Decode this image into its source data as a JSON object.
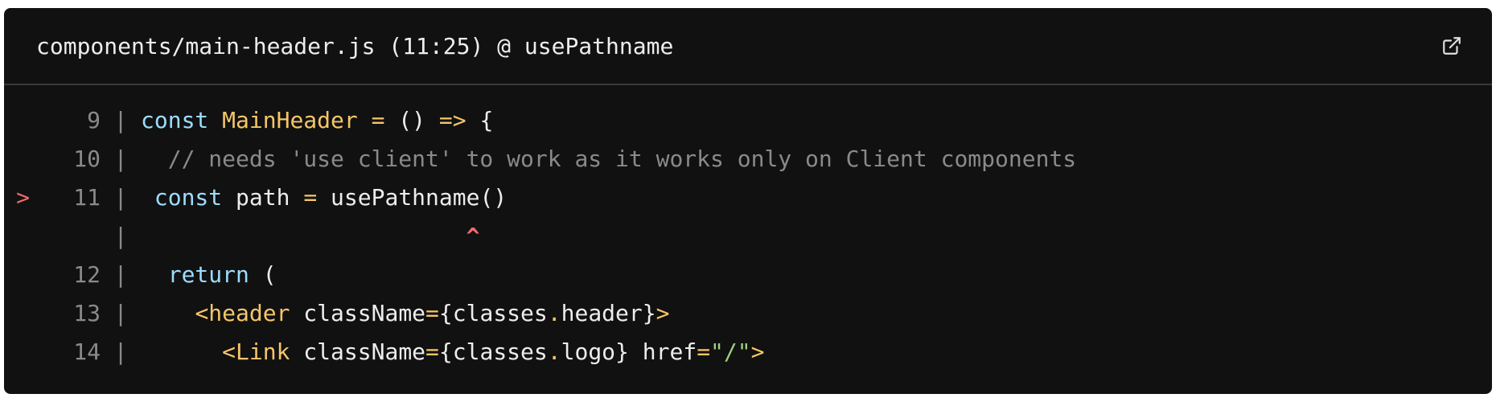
{
  "header": {
    "file_path": "components/main-header.js (11:25) @ usePathname",
    "open_icon": "external-link-icon"
  },
  "colors": {
    "background": "#111111",
    "keyword": "#9cdcfe",
    "identifier": "#f5c66a",
    "comment": "#8a8a8a",
    "string": "#9ad07a",
    "error_marker": "#ef6b6b"
  },
  "code": {
    "lines": [
      {
        "marker": "",
        "number": "9",
        "tokens": [
          {
            "t": "const",
            "k": "keyword"
          },
          {
            "t": " ",
            "k": "plain"
          },
          {
            "t": "MainHeader",
            "k": "name"
          },
          {
            "t": " ",
            "k": "plain"
          },
          {
            "t": "=",
            "k": "op"
          },
          {
            "t": " () ",
            "k": "punct"
          },
          {
            "t": "=>",
            "k": "arrow"
          },
          {
            "t": " {",
            "k": "punct"
          }
        ]
      },
      {
        "marker": "",
        "number": "10",
        "tokens": [
          {
            "t": "  // needs 'use client' to work as it works only on Client components",
            "k": "comment"
          }
        ]
      },
      {
        "marker": ">",
        "number": "11",
        "tokens": [
          {
            "t": " ",
            "k": "plain"
          },
          {
            "t": "const",
            "k": "keyword"
          },
          {
            "t": " path ",
            "k": "plain"
          },
          {
            "t": "=",
            "k": "op"
          },
          {
            "t": " usePathname()",
            "k": "plain"
          }
        ]
      },
      {
        "marker": "",
        "number": "",
        "tokens": [
          {
            "t": "                        ",
            "k": "plain"
          },
          {
            "t": "^",
            "k": "caret"
          }
        ]
      },
      {
        "marker": "",
        "number": "12",
        "tokens": [
          {
            "t": "  ",
            "k": "plain"
          },
          {
            "t": "return",
            "k": "keyword"
          },
          {
            "t": " (",
            "k": "punct"
          }
        ]
      },
      {
        "marker": "",
        "number": "13",
        "tokens": [
          {
            "t": "    ",
            "k": "plain"
          },
          {
            "t": "<header",
            "k": "tag"
          },
          {
            "t": " className",
            "k": "plain"
          },
          {
            "t": "=",
            "k": "op"
          },
          {
            "t": "{classes",
            "k": "plain"
          },
          {
            "t": ".",
            "k": "op"
          },
          {
            "t": "header}",
            "k": "plain"
          },
          {
            "t": ">",
            "k": "tag"
          }
        ]
      },
      {
        "marker": "",
        "number": "14",
        "tokens": [
          {
            "t": "      ",
            "k": "plain"
          },
          {
            "t": "<Link",
            "k": "tag"
          },
          {
            "t": " className",
            "k": "plain"
          },
          {
            "t": "=",
            "k": "op"
          },
          {
            "t": "{classes",
            "k": "plain"
          },
          {
            "t": ".",
            "k": "op"
          },
          {
            "t": "logo} href",
            "k": "plain"
          },
          {
            "t": "=",
            "k": "op"
          },
          {
            "t": "\"/\"",
            "k": "string"
          },
          {
            "t": ">",
            "k": "tag"
          }
        ]
      }
    ],
    "pipe": "|"
  }
}
